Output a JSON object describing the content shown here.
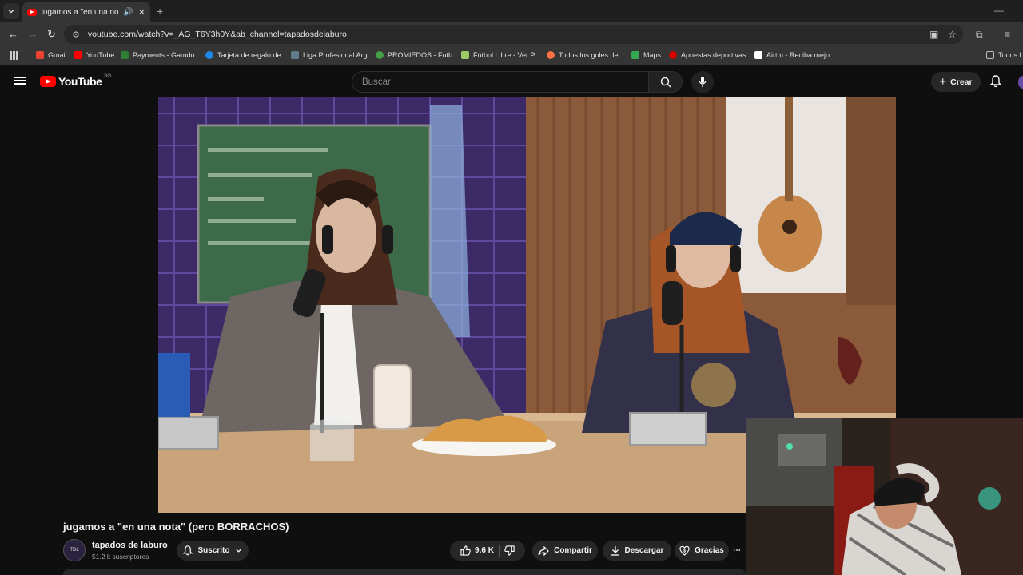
{
  "browser": {
    "tab_title": "jugamos a \"en una nota\" (p",
    "url": "youtube.com/watch?v=_AG_T6Y3h0Y&ab_channel=tapadosdelaburo"
  },
  "bookmarks": [
    {
      "label": "Gmail",
      "color": "#ea4335"
    },
    {
      "label": "YouTube",
      "color": "#ff0000"
    },
    {
      "label": "Payments - Gamdo...",
      "color": "#2e7d32"
    },
    {
      "label": "Tarjeta de regalo de...",
      "color": "#1e88e5"
    },
    {
      "label": "Liga Profesional Arg...",
      "color": "#607d8b"
    },
    {
      "label": "PROMIEDOS - Futb...",
      "color": "#43a047"
    },
    {
      "label": "Fútbol Libre - Ver P...",
      "color": "#9ccc65"
    },
    {
      "label": "Todos los goles de...",
      "color": "#ff7043"
    },
    {
      "label": "Maps",
      "color": "#34a853"
    },
    {
      "label": "Apuestas deportivas...",
      "color": "#d50000"
    },
    {
      "label": "Airtm - Reciba mejo...",
      "color": "#ffffff"
    },
    {
      "label": "Todos l",
      "color": "#bdbdbd"
    }
  ],
  "youtube": {
    "logo_text": "YouTube",
    "country_code": "BO",
    "search_placeholder": "Buscar",
    "create_label": "Crear"
  },
  "video": {
    "title": "jugamos a \"en una nota\" (pero BORRACHOS)",
    "channel_name": "tapados de laburo",
    "subscribers": "51.2 k suscriptores",
    "subscribed_label": "Suscrito",
    "likes": "9.6 K",
    "share_label": "Compartir",
    "download_label": "Descargar",
    "thanks_label": "Gracias",
    "channel_avatar_text": "TDL"
  },
  "colors": {
    "accent": "#ff0000",
    "background": "#0f0f0f",
    "surface": "#272727"
  }
}
